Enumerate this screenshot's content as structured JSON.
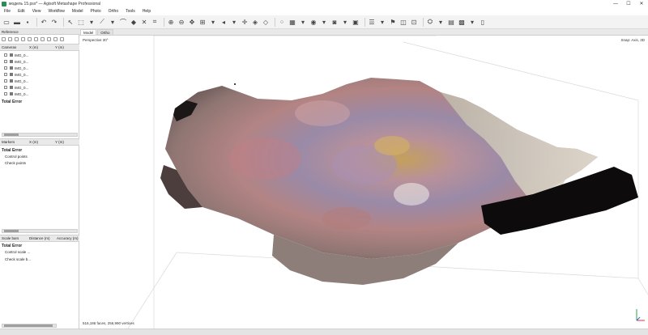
{
  "window": {
    "title": "модель 15.psx* — Agisoft Metashape Professional",
    "controls": [
      "—",
      "☐",
      "✕"
    ]
  },
  "menu": [
    "File",
    "Edit",
    "View",
    "Workflow",
    "Model",
    "Photo",
    "Ortho",
    "Tools",
    "Help"
  ],
  "reference_panel": {
    "tab": "Reference",
    "cameras": {
      "headers": [
        "Cameras",
        "X (m)",
        "Y (m)"
      ],
      "rows": [
        "IMG_0...",
        "IMG_0...",
        "IMG_0...",
        "IMG_0...",
        "IMG_0...",
        "IMG_0...",
        "IMG_0..."
      ],
      "total_error": "Total Error"
    },
    "markers": {
      "headers": [
        "Markers",
        "X (m)",
        "Y (m)"
      ],
      "total_error": "Total Error",
      "items": [
        "Control points",
        "Check points"
      ]
    },
    "scale_bars": {
      "headers": [
        "Scale bars",
        "Distance (m)",
        "Accuracy (m)"
      ],
      "total_error": "Total Error",
      "items": [
        "Control scale ...",
        "Check scale b..."
      ]
    }
  },
  "view_tabs": [
    "Model",
    "Ortho"
  ],
  "viewport": {
    "perspective": "Perspective 30°",
    "snap": "Snap: Axis, 3D",
    "stats": "516,186 faces, 256,990 vertices"
  }
}
